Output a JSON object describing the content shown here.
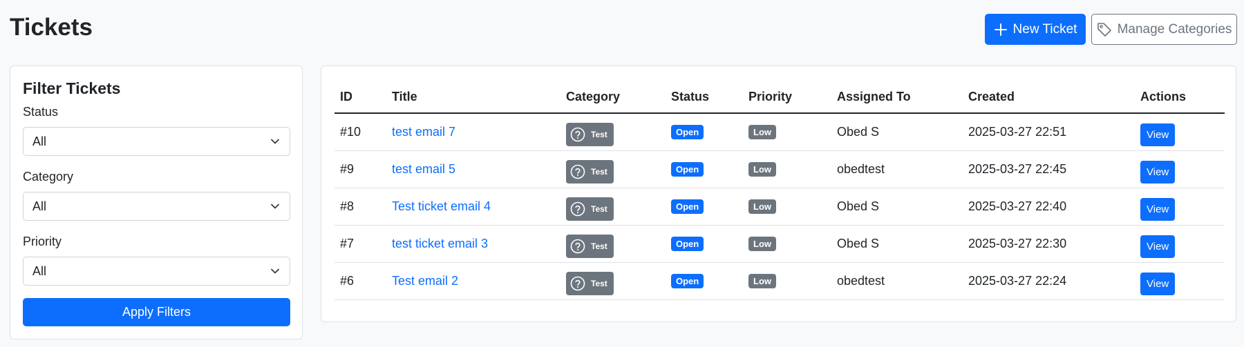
{
  "header": {
    "title": "Tickets",
    "new_ticket_label": "New Ticket",
    "manage_categories_label": "Manage Categories"
  },
  "filters": {
    "title": "Filter Tickets",
    "status_label": "Status",
    "status_value": "All",
    "category_label": "Category",
    "category_value": "All",
    "priority_label": "Priority",
    "priority_value": "All",
    "apply_label": "Apply Filters"
  },
  "table": {
    "headers": [
      "ID",
      "Title",
      "Category",
      "Status",
      "Priority",
      "Assigned To",
      "Created",
      "Actions"
    ],
    "rows": [
      {
        "id": "#10",
        "title": "test email 7",
        "category": "Test",
        "status": "Open",
        "priority": "Low",
        "assigned": "Obed S",
        "created": "2025-03-27 22:51",
        "action": "View"
      },
      {
        "id": "#9",
        "title": "test email 5",
        "category": "Test",
        "status": "Open",
        "priority": "Low",
        "assigned": "obedtest",
        "created": "2025-03-27 22:45",
        "action": "View"
      },
      {
        "id": "#8",
        "title": "Test ticket email 4",
        "category": "Test",
        "status": "Open",
        "priority": "Low",
        "assigned": "Obed S",
        "created": "2025-03-27 22:40",
        "action": "View"
      },
      {
        "id": "#7",
        "title": "test ticket email 3",
        "category": "Test",
        "status": "Open",
        "priority": "Low",
        "assigned": "Obed S",
        "created": "2025-03-27 22:30",
        "action": "View"
      },
      {
        "id": "#6",
        "title": "Test email 2",
        "category": "Test",
        "status": "Open",
        "priority": "Low",
        "assigned": "obedtest",
        "created": "2025-03-27 22:24",
        "action": "View"
      }
    ]
  },
  "colors": {
    "primary": "#0d6efd",
    "secondary": "#6c757d",
    "background": "#f8f9fa"
  },
  "icons": {
    "new_ticket": "plus-icon",
    "manage_categories": "tag-icon",
    "category": "question-circle-icon",
    "select": "chevron-down-icon"
  }
}
